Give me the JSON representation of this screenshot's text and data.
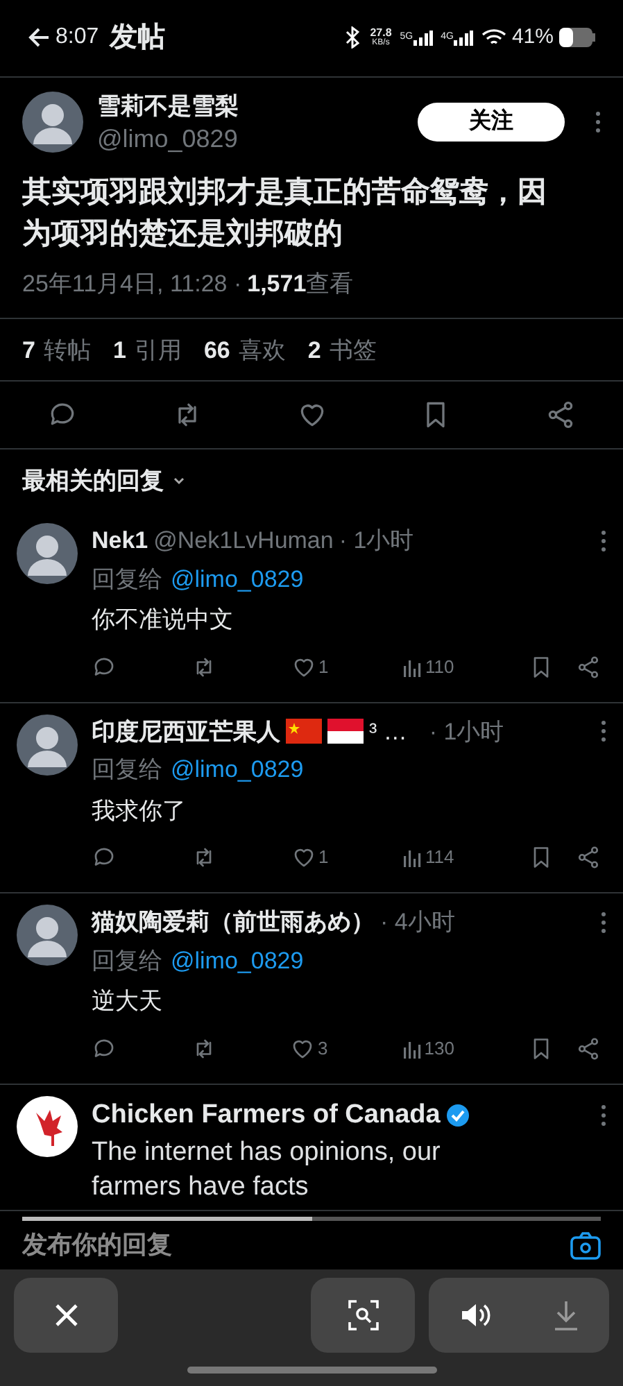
{
  "status_bar": {
    "time": "8:07",
    "network_speed": "27.8",
    "network_unit": "KB/s",
    "signal_1": "5G",
    "signal_2": "4G",
    "battery": "41%"
  },
  "header": {
    "title": "发帖"
  },
  "post": {
    "author": "雪莉不是雪梨",
    "handle": "@limo_0829",
    "follow_button": "关注",
    "text": "其实项羽跟刘邦才是真正的苦命鸳鸯，因为项羽的楚还是刘邦破的",
    "date": "25年11月4日, 11:28 ·",
    "views_count": "1,571",
    "views_label": "查看",
    "stats": [
      {
        "count": "7",
        "label": "转帖"
      },
      {
        "count": "1",
        "label": "引用"
      },
      {
        "count": "66",
        "label": "喜欢"
      },
      {
        "count": "2",
        "label": "书签"
      }
    ]
  },
  "replies_sort": {
    "label": "最相关的回复"
  },
  "replies": [
    {
      "kind": "reply",
      "name": "Nek1",
      "handle": "@Nek1LvHuman",
      "time": "· 1小时",
      "reply_to": "回复给",
      "mention": "@limo_0829",
      "text": "你不准说中文",
      "likes": "1",
      "views": "110"
    },
    {
      "kind": "reply",
      "name": "印度尼西亚芒果人",
      "flags": [
        {
          "kind": "star"
        },
        {
          "kind": "bicolor"
        }
      ],
      "name_suffix": "³ …",
      "time": "· 1小时",
      "reply_to": "回复给",
      "mention": "@limo_0829",
      "text": "我求你了",
      "likes": "1",
      "views": "114"
    },
    {
      "kind": "reply",
      "name": "猫奴陶爱莉（前世雨あめ）",
      "time": "· 4小时",
      "reply_to": "回复给",
      "mention": "@limo_0829",
      "text": "逆大天",
      "likes": "3",
      "views": "130"
    },
    {
      "kind": "promoted",
      "name": "Chicken Farmers of Canada",
      "verified": true,
      "text": "The internet has opinions, our farmers have facts"
    }
  ],
  "reply_field": {
    "placeholder": "发布你的回复"
  },
  "player": {
    "level": 0.5
  }
}
